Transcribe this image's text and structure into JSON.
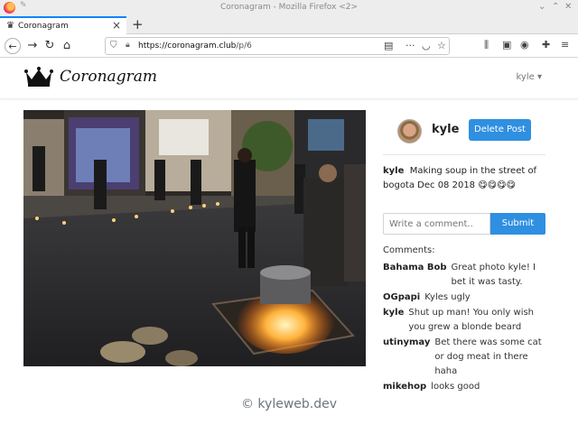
{
  "window": {
    "title": "Coronagram - Mozilla Firefox <2>"
  },
  "tab": {
    "title": "Coronagram"
  },
  "url": {
    "host": "https://coronagram.club",
    "path": "/p/6"
  },
  "site": {
    "brand": "Coronagram",
    "user_menu": "kyle"
  },
  "post": {
    "owner": "kyle",
    "delete_label": "Delete Post",
    "caption_user": "kyle",
    "caption_text": "Making soup in the street of bogota Dec 08 2018 😋😋😋😋"
  },
  "comment_form": {
    "placeholder": "Write a comment..",
    "submit_label": "Submit"
  },
  "comments_label": "Comments:",
  "comments": [
    {
      "user": "Bahama Bob",
      "text": "Great photo kyle! I bet it was tasty."
    },
    {
      "user": "OGpapi",
      "text": "Kyles ugly"
    },
    {
      "user": "kyle",
      "text": "Shut up man! You only wish you grew a blonde beard"
    },
    {
      "user": "utinymay",
      "text": "Bet there was some cat or dog meat in there haha"
    },
    {
      "user": "mikehop",
      "text": "looks good"
    }
  ],
  "footer": "© kyleweb.dev"
}
